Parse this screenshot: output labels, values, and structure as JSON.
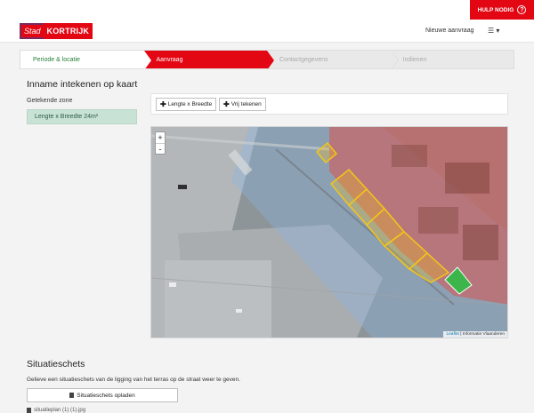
{
  "help": {
    "label": "HULP NODIG",
    "icon": "question-circle-icon"
  },
  "header": {
    "logo_stad": "Stad",
    "logo_name": "KORTRIJK",
    "new_request": "Nieuwe aanvraag",
    "menu_icon": "hamburger-menu-icon"
  },
  "steps": [
    {
      "label": "Periode & locatie",
      "state": "done"
    },
    {
      "label": "Aanvraag",
      "state": "active"
    },
    {
      "label": "Contactgegevens",
      "state": "pending"
    },
    {
      "label": "Indienen",
      "state": "pending"
    }
  ],
  "section": {
    "title": "Inname intekenen op kaart",
    "zones_label": "Getekende zone",
    "zones": [
      "Lengte x Breedte 24m²"
    ]
  },
  "toolbar": {
    "length_width": "Lengte x Breedte",
    "free_draw": "Vrij tekenen"
  },
  "map": {
    "zoom_in": "+",
    "zoom_out": "-",
    "attribution_leaflet": "Leaflet",
    "attribution_sep": " | ",
    "attribution_source": "Informatie Vlaanderen",
    "colors": {
      "drawn": "#f5c518",
      "selected": "#3cb54a",
      "zone_red": "#d9534f",
      "zone_blue": "#8ab4e8"
    }
  },
  "situation": {
    "title": "Situatieschets",
    "description": "Gelieve een situatieschets van de ligging van het terras op de straat weer te geven.",
    "upload_label": "Situatieschets opladen",
    "file_name": "situatieplan (1) (1).jpg"
  }
}
